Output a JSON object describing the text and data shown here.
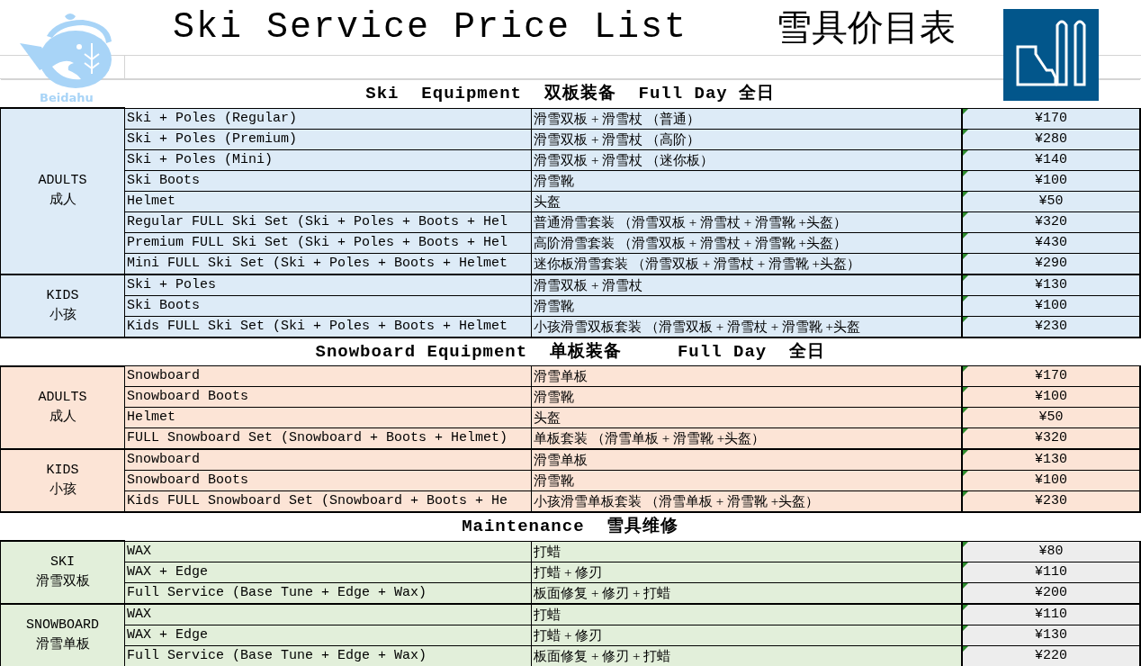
{
  "header": {
    "logo_text": "Beidahu",
    "title": "Ski Service Price List",
    "title_zh": "雪具价目表"
  },
  "sections": [
    {
      "title": "Ski  Equipment  双板装备  Full Day 全日",
      "color": "#ddebf7",
      "price_shaded": false,
      "groups": [
        {
          "label": "ADULTS",
          "label_zh": "成人",
          "items": [
            {
              "name": "Ski + Poles (Regular)",
              "name_zh": "滑雪双板 + 滑雪杖 （普通）",
              "price": "¥170"
            },
            {
              "name": "Ski + Poles (Premium)",
              "name_zh": "滑雪双板 + 滑雪杖 （高阶）",
              "price": "¥280"
            },
            {
              "name": "Ski + Poles (Mini)",
              "name_zh": "滑雪双板 + 滑雪杖 （迷你板）",
              "price": "¥140"
            },
            {
              "name": "Ski Boots",
              "name_zh": "滑雪靴",
              "price": "¥100"
            },
            {
              "name": "Helmet",
              "name_zh": "头盔",
              "price": "¥50"
            },
            {
              "name": "Regular FULL Ski Set (Ski + Poles + Boots + Hel",
              "name_zh": "普通滑雪套装 （滑雪双板 + 滑雪杖 + 滑雪靴 +头盔）",
              "price": "¥320"
            },
            {
              "name": "Premium FULL Ski Set (Ski + Poles + Boots + Hel",
              "name_zh": "高阶滑雪套装 （滑雪双板 + 滑雪杖 + 滑雪靴 +头盔）",
              "price": "¥430"
            },
            {
              "name": "Mini FULL Ski Set (Ski + Poles + Boots + Helmet",
              "name_zh": "迷你板滑雪套装 （滑雪双板 + 滑雪杖 + 滑雪靴 +头盔）",
              "price": "¥290"
            }
          ]
        },
        {
          "label": "KIDS",
          "label_zh": "小孩",
          "items": [
            {
              "name": "Ski + Poles",
              "name_zh": "滑雪双板 + 滑雪杖",
              "price": "¥130"
            },
            {
              "name": "Ski Boots",
              "name_zh": "滑雪靴",
              "price": "¥100"
            },
            {
              "name": "Kids FULL Ski Set (Ski + Poles + Boots + Helmet",
              "name_zh": "小孩滑雪双板套装 （滑雪双板 + 滑雪杖 + 滑雪靴 +头盔",
              "price": "¥230"
            }
          ]
        }
      ]
    },
    {
      "title": "Snowboard Equipment  单板装备     Full Day  全日",
      "color": "#fce4d6",
      "price_shaded": false,
      "groups": [
        {
          "label": "ADULTS",
          "label_zh": "成人",
          "items": [
            {
              "name": "Snowboard",
              "name_zh": "滑雪单板",
              "price": "¥170"
            },
            {
              "name": "Snowboard Boots",
              "name_zh": "滑雪靴",
              "price": "¥100"
            },
            {
              "name": "Helmet",
              "name_zh": "头盔",
              "price": "¥50"
            },
            {
              "name": "FULL Snowboard Set (Snowboard + Boots + Helmet)",
              "name_zh": "单板套装 （滑雪单板 + 滑雪靴 +头盔）",
              "price": "¥320"
            }
          ]
        },
        {
          "label": "KIDS",
          "label_zh": "小孩",
          "items": [
            {
              "name": "Snowboard",
              "name_zh": "滑雪单板",
              "price": "¥130"
            },
            {
              "name": "Snowboard Boots",
              "name_zh": "滑雪靴",
              "price": "¥100"
            },
            {
              "name": "Kids FULL Snowboard Set (Snowboard + Boots + He",
              "name_zh": "小孩滑雪单板套装 （滑雪单板 + 滑雪靴 +头盔）",
              "price": "¥230"
            }
          ]
        }
      ]
    },
    {
      "title": "Maintenance  雪具维修",
      "color": "#e2efda",
      "price_shaded": true,
      "groups": [
        {
          "label": "SKI",
          "label_zh": "滑雪双板",
          "items": [
            {
              "name": "WAX",
              "name_zh": "打蜡",
              "price": "¥80"
            },
            {
              "name": "WAX + Edge",
              "name_zh": "打蜡 + 修刃",
              "price": "¥110"
            },
            {
              "name": "Full Service (Base Tune + Edge + Wax)",
              "name_zh": "板面修复 + 修刃 + 打蜡",
              "price": "¥200"
            }
          ]
        },
        {
          "label": "SNOWBOARD",
          "label_zh": "滑雪单板",
          "items": [
            {
              "name": "WAX",
              "name_zh": "打蜡",
              "price": "¥110"
            },
            {
              "name": "WAX + Edge",
              "name_zh": "打蜡 + 修刃",
              "price": "¥130"
            },
            {
              "name": "Full Service (Base Tune + Edge + Wax)",
              "name_zh": "板面修复 + 修刃 + 打蜡",
              "price": "¥220"
            }
          ]
        }
      ]
    }
  ]
}
